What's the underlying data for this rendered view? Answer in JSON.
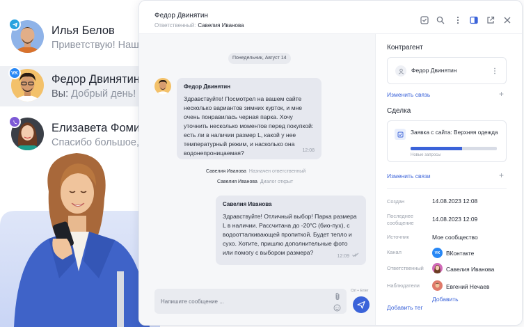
{
  "contacts": [
    {
      "name": "Илья Белов",
      "preview": "Приветствую! Наша",
      "channel": "telegram",
      "channel_color": "#2aa3df"
    },
    {
      "name": "Федор Двинятин",
      "preview_prefix": "Вы:",
      "preview": "Добрый день! Рег",
      "channel": "vk",
      "channel_color": "#2787f5"
    },
    {
      "name": "Елизавета Фомина",
      "preview": "Спасибо большое, п",
      "channel": "viber",
      "channel_color": "#7d5ad6"
    }
  ],
  "window": {
    "title": "Федор Двинятин",
    "responsible_label": "Ответственный:",
    "responsible_name": "Савелия Иванова",
    "icons": [
      "check-square-icon",
      "search-icon",
      "more-vertical-icon",
      "panel-icon",
      "external-link-icon",
      "close-icon"
    ]
  },
  "chat": {
    "date": "Понедельник, Август 14",
    "incoming": {
      "author": "Федор Двинятин",
      "text": "Здравствуйте! Посмотрел на вашем сайте несколько вариантов зимних курток, и мне очень понравилась черная парка. Хочу уточнить несколько моментов перед покупкой: есть ли в наличии размер L, какой у нее температурный режим, и насколько она водонепроницаемая?",
      "time": "12:08"
    },
    "system": [
      {
        "actor": "Савелия Иванова",
        "action": "Назначен ответственный"
      },
      {
        "actor": "Савелия Иванова",
        "action": "Диалог открыт"
      }
    ],
    "outgoing": {
      "author": "Савелия Иванова",
      "text": "Здравствуйте! Отличный выбор! Парка размера L в наличии. Рассчитана до -20°C (био-пух), с водоотталкивающей пропиткой. Будет тепло и сухо. Хотите, пришлю дополнительные фото или помогу с выбором размера?",
      "time": "12:09"
    },
    "composer_placeholder": "Напишите сообщение ...",
    "send_hint": "Ctrl + Enter"
  },
  "panel": {
    "contractor_title": "Контрагент",
    "contractor_name": "Федор Двинятин",
    "change_link_1": "Изменить связь",
    "deal_title": "Сделка",
    "deal_name": "Заявка с сайта: Верхняя одежда",
    "deal_stage": "Новые запросы",
    "deal_progress": 0.6,
    "change_link_2": "Изменить связи",
    "fields": [
      {
        "label": "Создан",
        "value": "14.08.2023 12:08"
      },
      {
        "label": "Последнее сообщение",
        "value": "14.08.2023 12:09"
      },
      {
        "label": "Источник",
        "value": "Мое сообщество"
      },
      {
        "label": "Канал",
        "value": "ВКонтакте"
      },
      {
        "label": "Ответственный",
        "value": "Савелия Иванова"
      },
      {
        "label": "Наблюдатели",
        "value": "Евгений Нечаев"
      }
    ],
    "add_observer": "Добавить",
    "add_tag": "Добавить тег"
  },
  "colors": {
    "accent": "#3b63d9",
    "bubble": "#e6e8ef",
    "chat_bg": "#f6f7f9"
  }
}
